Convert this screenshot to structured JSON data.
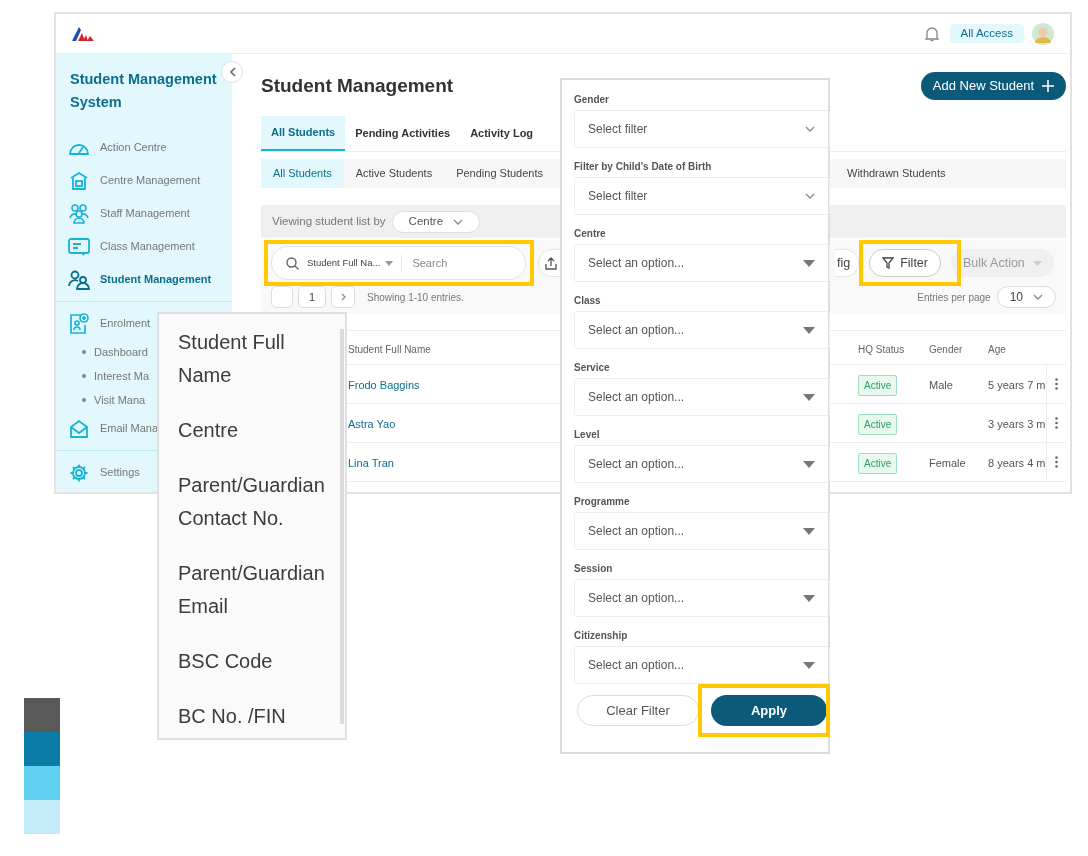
{
  "header": {
    "access_badge": "All Access"
  },
  "sidebar": {
    "title": "Student Management System",
    "sections": [
      {
        "items": [
          {
            "label": "Action Centre",
            "kind": "gauge",
            "selected": false
          },
          {
            "label": "Centre Management",
            "kind": "building",
            "selected": false
          },
          {
            "label": "Staff Management",
            "kind": "people",
            "selected": false
          },
          {
            "label": "Class Management",
            "kind": "board",
            "selected": false
          },
          {
            "label": "Student Management",
            "kind": "students",
            "selected": true
          }
        ]
      },
      {
        "items": [
          {
            "label": "Enrolment",
            "kind": "form",
            "selected": false,
            "children": [
              {
                "label": "Dashboard"
              },
              {
                "label": "Interest Ma"
              },
              {
                "label": "Visit Mana"
              }
            ]
          },
          {
            "label": "Email Mana",
            "kind": "mail",
            "selected": false
          }
        ]
      },
      {
        "items": [
          {
            "label": "Settings",
            "kind": "gear",
            "selected": false
          }
        ]
      }
    ]
  },
  "page": {
    "title": "Student Management",
    "add_button": "Add New Student"
  },
  "tabs": [
    {
      "label": "All Students",
      "selected": true
    },
    {
      "label": "Pending Activities",
      "selected": false
    },
    {
      "label": "Activity Log",
      "selected": false
    }
  ],
  "subtabs": [
    {
      "label": "All Students",
      "selected": true
    },
    {
      "label": "Active Students",
      "selected": false
    },
    {
      "label": "Pending Students",
      "selected": false
    },
    {
      "label": "Withdrawn Students",
      "selected": false
    }
  ],
  "view_by": {
    "label": "Viewing student list by",
    "value": "Centre"
  },
  "toolbar": {
    "search": {
      "field": "Student Full Na...",
      "placeholder": "Search",
      "highlighted": true
    },
    "config_button": "fig",
    "filter_button": {
      "label": "Filter",
      "highlighted": true
    },
    "bulk_button": {
      "label": "Bulk Action",
      "disabled": true
    }
  },
  "pagination": {
    "page": "1",
    "summary": "Showing 1-10 entries.",
    "per_page_label": "Entries per page",
    "per_page": "10"
  },
  "table": {
    "columns": [
      "Student Full Name",
      "HQ Status",
      "Gender",
      "Age"
    ],
    "rows": [
      {
        "name": "Frodo Baggins",
        "status": "Active",
        "gender": "Male",
        "age": "5 years 7 m"
      },
      {
        "name": "Astra Yao",
        "status": "Active",
        "age": "3 years 3 m"
      },
      {
        "name": "Lina Tran",
        "status": "Active",
        "gender": "Female",
        "age": "8 years 4 m"
      }
    ]
  },
  "search_field_menu": [
    "Student Full Name",
    "Centre",
    "Parent/Guardian Contact No.",
    "Parent/Guardian Email",
    "BSC Code",
    "BC No. /FIN"
  ],
  "filter_panel": {
    "fields": [
      {
        "label": "Gender",
        "placeholder": "Select filter",
        "kind": "chevron"
      },
      {
        "label": "Filter by Child's Date of Birth",
        "placeholder": "Select filter",
        "kind": "chevron"
      },
      {
        "label": "Centre",
        "placeholder": "Select an option...",
        "kind": "caret"
      },
      {
        "label": "Class",
        "placeholder": "Select an option...",
        "kind": "caret"
      },
      {
        "label": "Service",
        "placeholder": "Select an option...",
        "kind": "caret"
      },
      {
        "label": "Level",
        "placeholder": "Select an option...",
        "kind": "caret"
      },
      {
        "label": "Programme",
        "placeholder": "Select an option...",
        "kind": "caret"
      },
      {
        "label": "Session",
        "placeholder": "Select an option...",
        "kind": "caret"
      },
      {
        "label": "Citizenship",
        "placeholder": "Select an option...",
        "kind": "caret"
      }
    ],
    "clear_button": "Clear Filter",
    "apply_button": {
      "label": "Apply",
      "highlighted": true
    }
  },
  "swatches": [
    {
      "color": "#595959"
    },
    {
      "color": "#0a7aa6"
    },
    {
      "color": "#5fd0f0"
    },
    {
      "color": "#c4ebf9"
    }
  ]
}
